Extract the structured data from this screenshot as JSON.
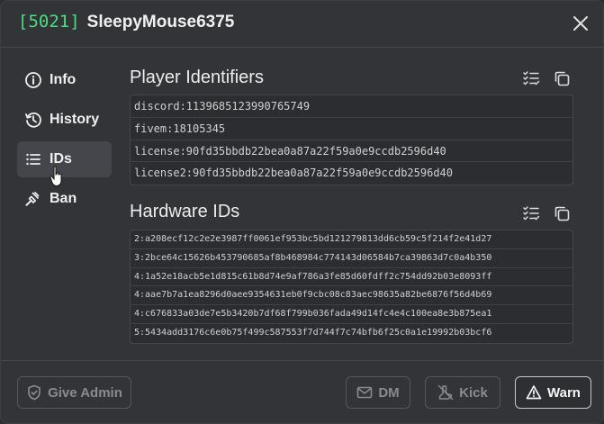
{
  "header": {
    "player_id": "[5021]",
    "player_name": "SleepyMouse6375"
  },
  "sidebar": {
    "items": [
      {
        "label": "Info",
        "icon": "info-circle-icon"
      },
      {
        "label": "History",
        "icon": "history-clock-icon"
      },
      {
        "label": "IDs",
        "icon": "list-icon",
        "active": true
      },
      {
        "label": "Ban",
        "icon": "gavel-icon"
      }
    ]
  },
  "player_identifiers": {
    "title": "Player Identifiers",
    "rows": [
      "discord:1139685123990765749",
      "fivem:18105345",
      "license:90fd35bbdb22bea0a87a22f59a0e9ccdb2596d40",
      "license2:90fd35bbdb22bea0a87a22f59a0e9ccdb2596d40"
    ]
  },
  "hardware_ids": {
    "title": "Hardware IDs",
    "rows": [
      "2:a208ecf12c2e2e3987ff0061ef953bc5bd121279813dd6cb59c5f214f2e41d27",
      "3:2bce64c15626b453790685af8b468984c774143d06584b7ca39863d7c0a4b350",
      "4:1a52e18acb5e1d815c61b8d74e9af786a3fe85d60fdff2c754dd92b03e8093ff",
      "4:aae7b7a1ea8296d0aee9354631eb0f9cbc08c83aec98635a82be6876f56d4b69",
      "4:c676833a03de7e5b3420b7df68f799b036fada49d14fc4e4c100ea8e3b875ea1",
      "5:5434add3176c6e0b75f499c587553f7d744f7c74bfb6f25c0a1e19992b03bcf6"
    ]
  },
  "footer": {
    "give_admin": "Give Admin",
    "dm": "DM",
    "kick": "Kick",
    "warn": "Warn"
  },
  "colors": {
    "id_green": "#4ade80",
    "background": "#333437",
    "active_item": "#45464b"
  }
}
